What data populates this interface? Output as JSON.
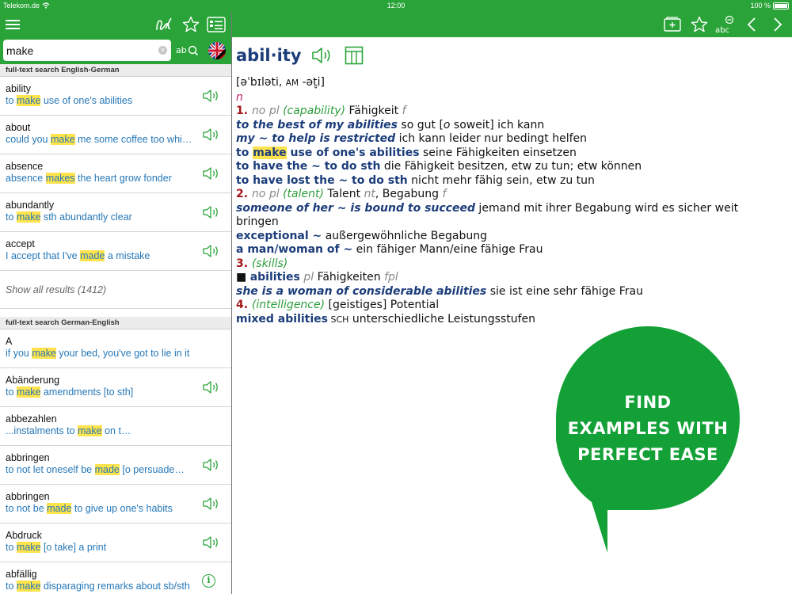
{
  "status_bar": {
    "carrier": "Telekom.de",
    "time": "12:00",
    "battery": "100 %"
  },
  "search": {
    "value": "make",
    "placeholder": ""
  },
  "sections": [
    {
      "title": "full-text search English-German",
      "items": [
        {
          "headword": "ability",
          "example": [
            [
              "to ",
              false
            ],
            [
              "make",
              true
            ],
            [
              " use of one's abilities",
              false
            ]
          ],
          "action": "speaker"
        },
        {
          "headword": "about",
          "example": [
            [
              "could you ",
              false
            ],
            [
              "make",
              true
            ],
            [
              " me some coffee too whi…",
              false
            ]
          ],
          "action": "speaker"
        },
        {
          "headword": "absence",
          "example": [
            [
              "absence ",
              false
            ],
            [
              "makes",
              true
            ],
            [
              " the heart grow fonder",
              false
            ]
          ],
          "action": "speaker"
        },
        {
          "headword": "abundantly",
          "example": [
            [
              "to ",
              false
            ],
            [
              "make",
              true
            ],
            [
              " sth abundantly clear",
              false
            ]
          ],
          "action": "speaker"
        },
        {
          "headword": "accept",
          "example": [
            [
              "I accept that I've ",
              false
            ],
            [
              "made",
              true
            ],
            [
              " a mistake",
              false
            ]
          ],
          "action": "speaker"
        }
      ],
      "show_all": "Show all results (1412)"
    },
    {
      "title": "full-text search German-English",
      "items": [
        {
          "headword": "A",
          "example": [
            [
              "if you ",
              false
            ],
            [
              "make",
              true
            ],
            [
              " your bed, you've got to lie in it",
              false
            ]
          ],
          "action": "none"
        },
        {
          "headword": "Abänderung",
          "example": [
            [
              "to ",
              false
            ],
            [
              "make",
              true
            ],
            [
              " amendments [to sth]",
              false
            ]
          ],
          "action": "speaker"
        },
        {
          "headword": "abbezahlen",
          "example": [
            [
              "...instalments to ",
              false
            ],
            [
              "make",
              true
            ],
            [
              " on t…",
              false
            ]
          ],
          "action": "none"
        },
        {
          "headword": "abbringen",
          "example": [
            [
              "to not let oneself be ",
              false
            ],
            [
              "made",
              true
            ],
            [
              " [o persuade…",
              false
            ]
          ],
          "action": "speaker"
        },
        {
          "headword": "abbringen",
          "example": [
            [
              "to not be ",
              false
            ],
            [
              "made",
              true
            ],
            [
              " to give up one's habits",
              false
            ]
          ],
          "action": "speaker"
        },
        {
          "headword": "Abdruck",
          "example": [
            [
              "to ",
              false
            ],
            [
              "make",
              true
            ],
            [
              " [o take] a print",
              false
            ]
          ],
          "action": "speaker"
        },
        {
          "headword": "abfällig",
          "example": [
            [
              "to ",
              false
            ],
            [
              "make",
              true
            ],
            [
              " disparaging remarks about sb/sth",
              false
            ]
          ],
          "action": "info"
        }
      ]
    }
  ],
  "entry": {
    "headword": "abil·ity",
    "pronunciation": "[əˈbɪləti, ",
    "pron_am": "AM",
    "pron_tail": " -ət̬i]",
    "pos": "n",
    "lines": [
      [
        {
          "t": "1. ",
          "c": "num"
        },
        {
          "t": "no pl ",
          "c": "gray"
        },
        {
          "t": "(capability) ",
          "c": "green"
        },
        {
          "t": "Fähigkeit ",
          "c": ""
        },
        {
          "t": "f",
          "c": "gray"
        }
      ],
      [
        {
          "t": "to the best of my abilities",
          "c": "ex-bold"
        },
        {
          "t": " so gut [",
          "c": ""
        },
        {
          "t": "o",
          "c": "ital"
        },
        {
          "t": " soweit] ich kann",
          "c": ""
        }
      ],
      [
        {
          "t": "my ~ to help is restricted",
          "c": "ex-bold"
        },
        {
          "t": " ich kann leider nur bedingt helfen",
          "c": ""
        }
      ],
      [
        {
          "t": "to ",
          "c": "phrase"
        },
        {
          "t": "make",
          "c": "phrase hl"
        },
        {
          "t": " use of one's abilities",
          "c": "phrase"
        },
        {
          "t": " seine Fähigkeiten einsetzen",
          "c": ""
        }
      ],
      [
        {
          "t": "to have the ~ to do sth",
          "c": "phrase"
        },
        {
          "t": " die Fähigkeit besitzen, etw zu tun; etw können",
          "c": ""
        }
      ],
      [
        {
          "t": "to have lost the ~ to do sth",
          "c": "phrase"
        },
        {
          "t": " nicht mehr fähig sein, etw zu tun",
          "c": ""
        }
      ],
      [
        {
          "t": "2. ",
          "c": "num"
        },
        {
          "t": "no pl ",
          "c": "gray"
        },
        {
          "t": "(talent) ",
          "c": "green"
        },
        {
          "t": "Talent ",
          "c": ""
        },
        {
          "t": "nt",
          "c": "gray"
        },
        {
          "t": ", Begabung ",
          "c": ""
        },
        {
          "t": "f",
          "c": "gray"
        }
      ],
      [
        {
          "t": "someone of her ~ is bound to succeed",
          "c": "ex-bold"
        },
        {
          "t": " jemand mit ihrer Begabung wird es sicher weit bringen",
          "c": ""
        }
      ],
      [
        {
          "t": "exceptional ~",
          "c": "phrase"
        },
        {
          "t": " außergewöhnliche Begabung",
          "c": ""
        }
      ],
      [
        {
          "t": "a man/woman of ~",
          "c": "phrase"
        },
        {
          "t": " ein fähiger Mann/eine fähige Frau",
          "c": ""
        }
      ],
      [
        {
          "t": "3. ",
          "c": "num"
        },
        {
          "t": "(skills)",
          "c": "green"
        }
      ],
      [
        {
          "t": "■ ",
          "c": ""
        },
        {
          "t": "abilities",
          "c": "phrase"
        },
        {
          "t": " pl ",
          "c": "gray"
        },
        {
          "t": "Fähigkeiten ",
          "c": ""
        },
        {
          "t": "fpl",
          "c": "gray"
        }
      ],
      [
        {
          "t": "she is a woman of considerable abilities",
          "c": "ex-bold"
        },
        {
          "t": " sie ist eine sehr fähige Frau",
          "c": ""
        }
      ],
      [
        {
          "t": "4. ",
          "c": "num"
        },
        {
          "t": "(intelligence)",
          "c": "green"
        },
        {
          "t": " [geistiges] Potential",
          "c": ""
        }
      ],
      [
        {
          "t": "mixed abilities",
          "c": "phrase"
        },
        {
          "t": " SCH",
          "c": "sm"
        },
        {
          "t": " unterschiedliche Leistungsstufen",
          "c": ""
        }
      ]
    ]
  },
  "promo": {
    "lines": [
      "FIND",
      "EXAMPLES WITH",
      "PERFECT EASE"
    ]
  },
  "colors": {
    "brand_green": "#2aa438",
    "highlight": "#ffe34d",
    "headword_blue": "#1b3d7a",
    "example_blue": "#2678b8",
    "sense_red": "#a4161a"
  },
  "icons": {
    "menu": "hamburger-menu-icon",
    "handwriting": "handwriting-icon",
    "favorites": "star-icon",
    "history": "history-list-icon",
    "abc_search": "abc-search-icon",
    "language": "uk-de-flag-icon",
    "add_card": "add-card-icon",
    "font_size": "font-size-icon",
    "back": "chevron-left-icon",
    "forward": "chevron-right-icon",
    "speaker": "speaker-icon",
    "table": "table-icon",
    "info": "info-icon"
  }
}
